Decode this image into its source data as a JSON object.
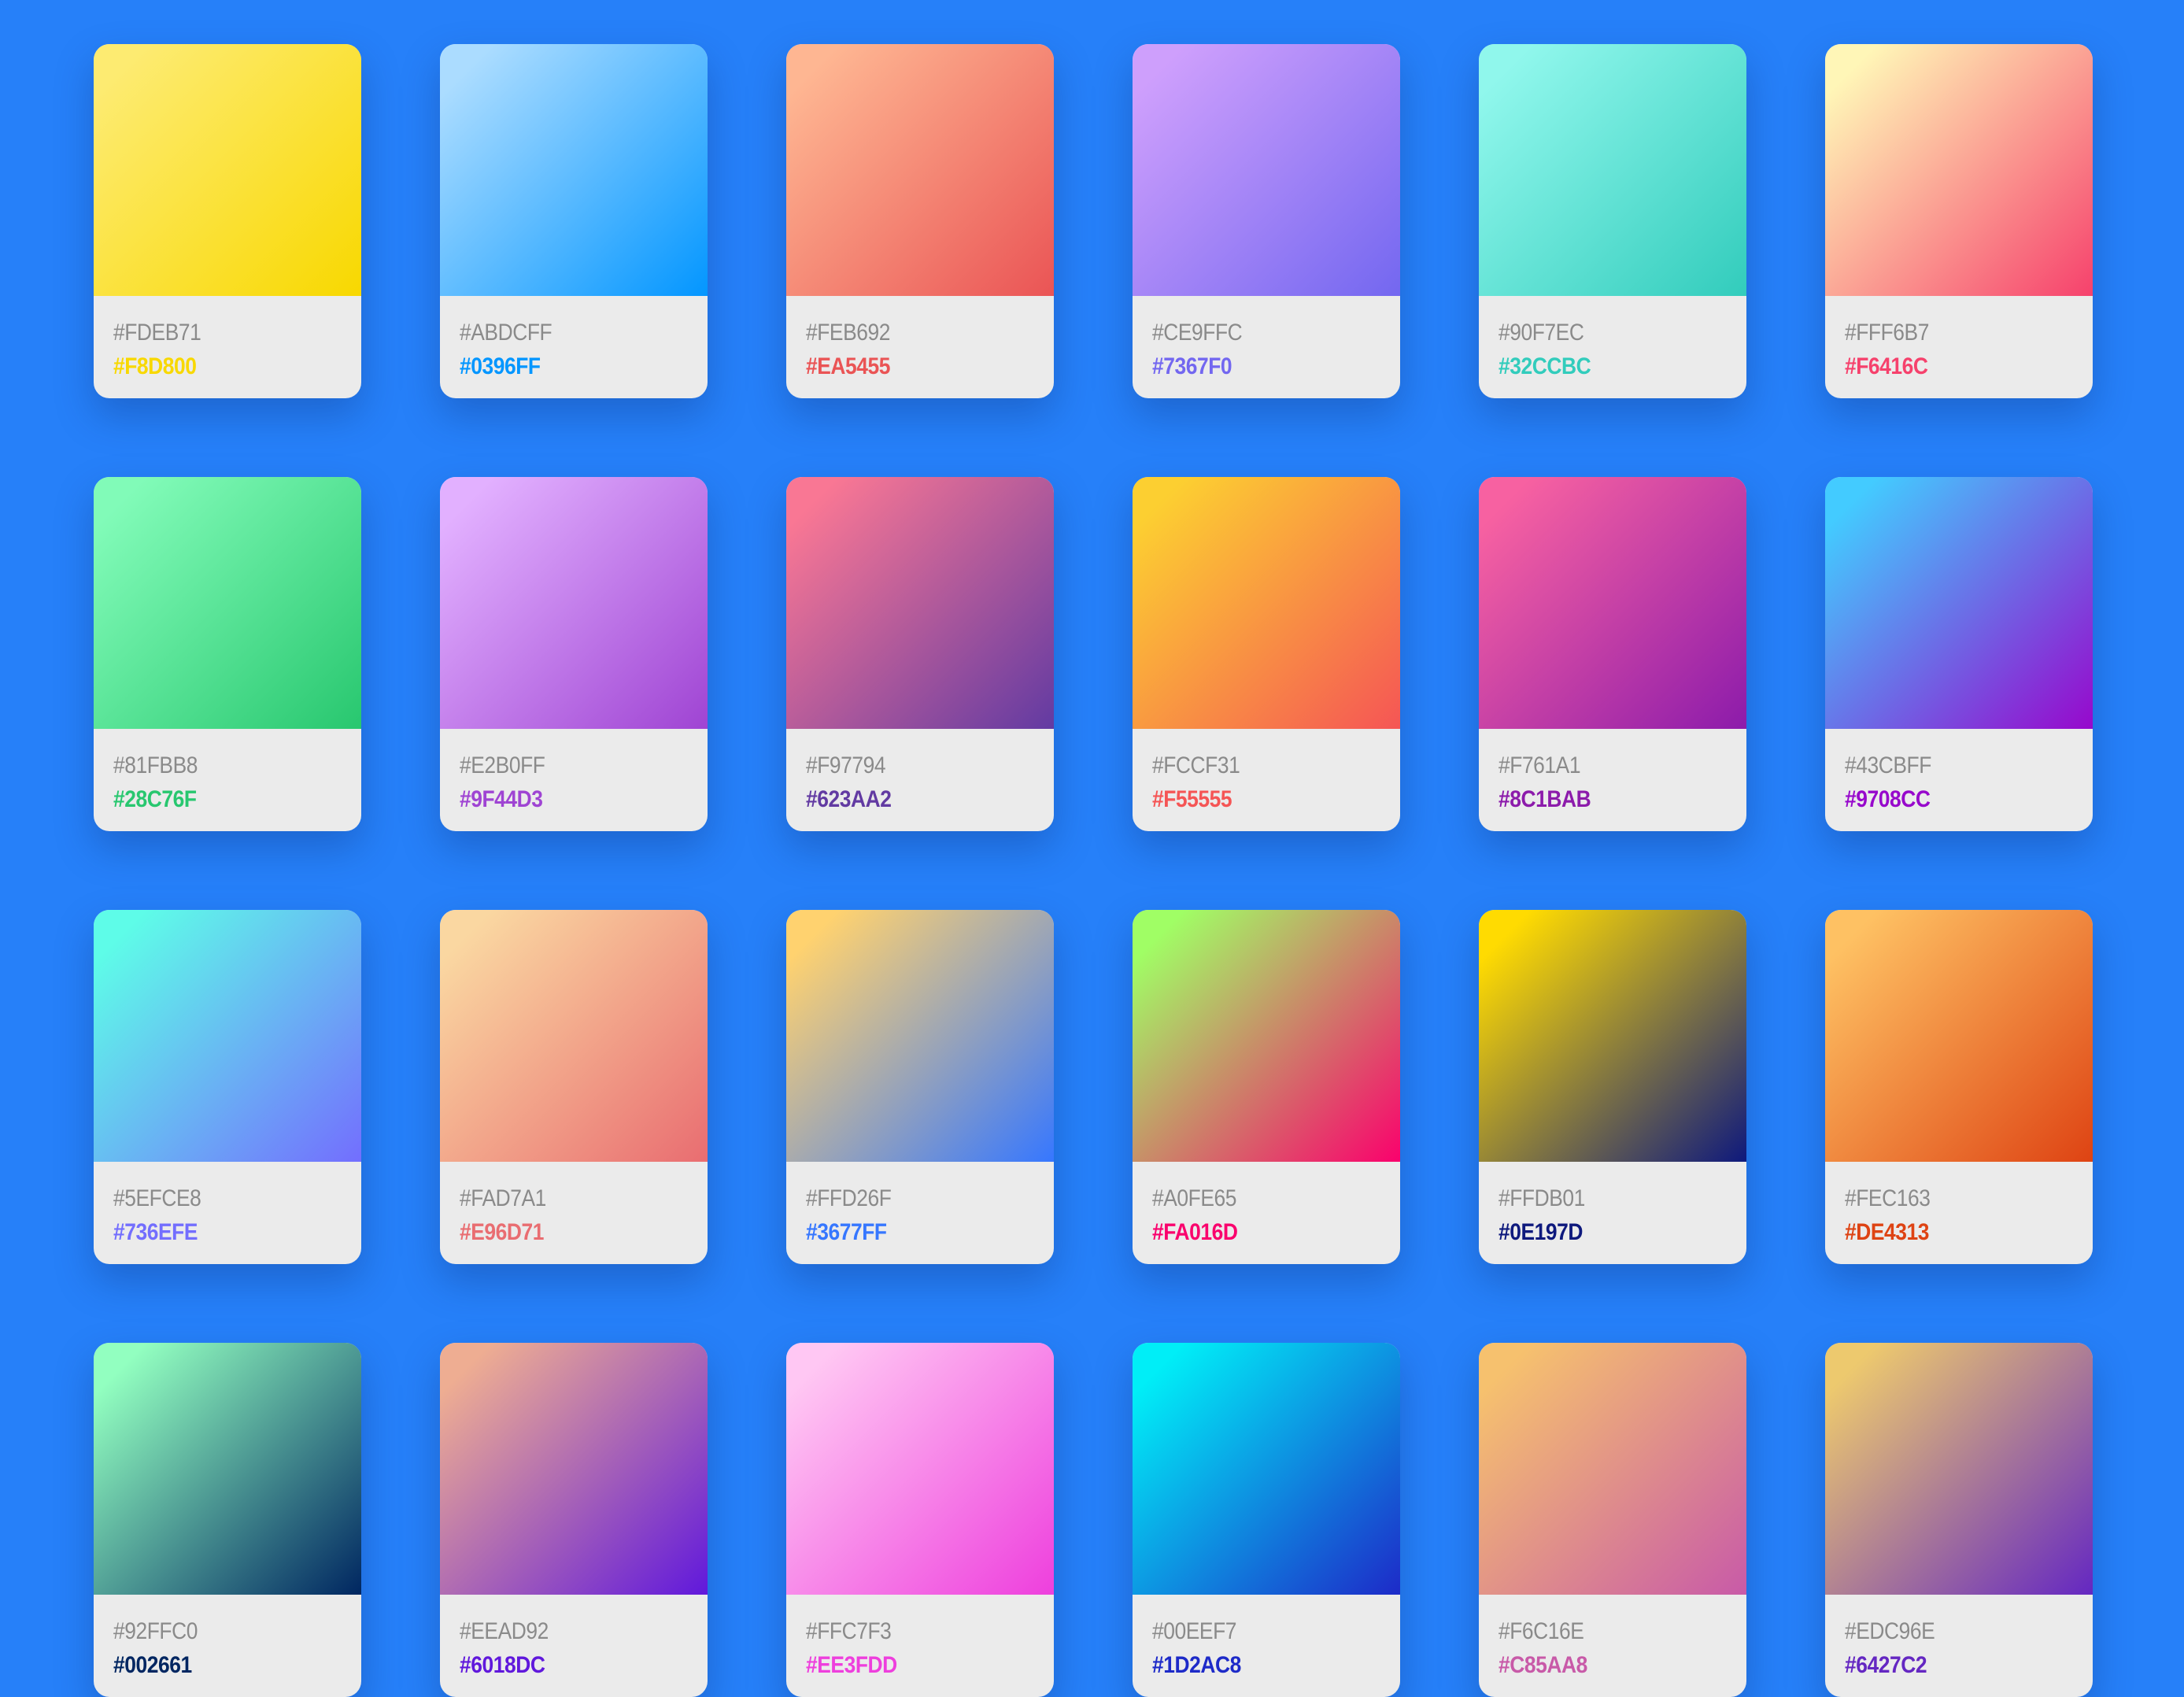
{
  "gradients": [
    {
      "from": "#FDEB71",
      "to": "#F8D800"
    },
    {
      "from": "#ABDCFF",
      "to": "#0396FF"
    },
    {
      "from": "#FEB692",
      "to": "#EA5455"
    },
    {
      "from": "#CE9FFC",
      "to": "#7367F0"
    },
    {
      "from": "#90F7EC",
      "to": "#32CCBC"
    },
    {
      "from": "#FFF6B7",
      "to": "#F6416C"
    },
    {
      "from": "#81FBB8",
      "to": "#28C76F"
    },
    {
      "from": "#E2B0FF",
      "to": "#9F44D3"
    },
    {
      "from": "#F97794",
      "to": "#623AA2"
    },
    {
      "from": "#FCCF31",
      "to": "#F55555"
    },
    {
      "from": "#F761A1",
      "to": "#8C1BAB"
    },
    {
      "from": "#43CBFF",
      "to": "#9708CC"
    },
    {
      "from": "#5EFCE8",
      "to": "#736EFE"
    },
    {
      "from": "#FAD7A1",
      "to": "#E96D71"
    },
    {
      "from": "#FFD26F",
      "to": "#3677FF"
    },
    {
      "from": "#A0FE65",
      "to": "#FA016D"
    },
    {
      "from": "#FFDB01",
      "to": "#0E197D"
    },
    {
      "from": "#FEC163",
      "to": "#DE4313"
    },
    {
      "from": "#92FFC0",
      "to": "#002661",
      "labels_visible": false
    },
    {
      "from": "#EEAD92",
      "to": "#6018DC",
      "labels_visible": false
    },
    {
      "from": "#FFC7F3",
      "to": "#EE3FDD",
      "labels_visible": false
    },
    {
      "from": "#00EEF7",
      "to": "#1D2AC8",
      "labels_visible": false
    },
    {
      "from": "#F6C16E",
      "to": "#C85AA8",
      "labels_visible": false
    },
    {
      "from": "#EDC96E",
      "to": "#6427C2",
      "labels_visible": false
    }
  ]
}
